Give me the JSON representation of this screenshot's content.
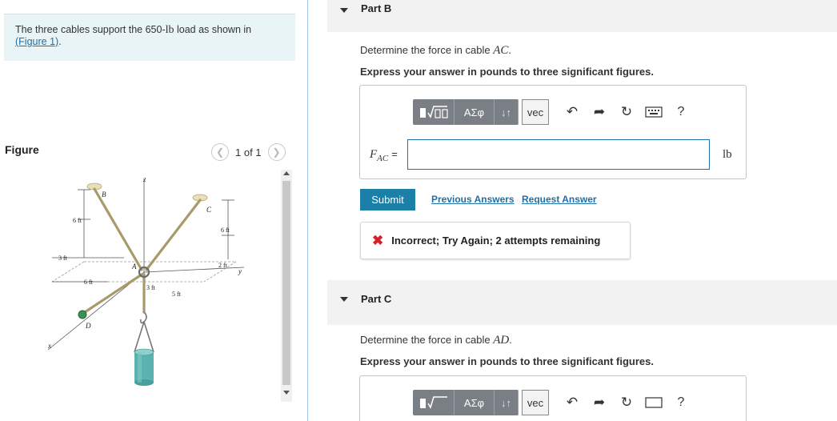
{
  "problem": {
    "text_before": "The three cables support the 650-",
    "unit": "lb",
    "text_after": " load as shown in",
    "figure_link": "(Figure 1)",
    "period": "."
  },
  "figure_panel": {
    "title": "Figure",
    "pager_text": "1 of 1",
    "prev_icon": "chevron-left-icon",
    "next_icon": "chevron-right-icon",
    "labels": {
      "B": "B",
      "C": "C",
      "A": "A",
      "D": "D",
      "z": "z",
      "y": "y",
      "x": "x",
      "dim_6ft_left": "6 ft",
      "dim_6ft_right": "6 ft",
      "dim_3ft_left": "3 ft",
      "dim_2ft": "2 ft",
      "dim_6ft_bottom": "6 ft",
      "dim_3ft_bottom": "3 ft",
      "dim_5ft": "5 ft"
    }
  },
  "part_b": {
    "title": "Part B",
    "question_prefix": "Determine the force in cable ",
    "question_var": "AC",
    "question_suffix": ".",
    "instruction": "Express your answer in pounds to three significant figures.",
    "toolbar": {
      "templates_icon": "math-templates-icon",
      "greek_label": "ΑΣφ",
      "updown_label": "↓↑",
      "vec_label": "vec",
      "undo_icon": "undo-icon",
      "redo_icon": "redo-icon",
      "reset_icon": "reset-icon",
      "keyboard_icon": "keyboard-icon",
      "help_label": "?"
    },
    "input_label_var": "F",
    "input_label_sub": "AC",
    "input_label_eq": "=",
    "input_value": "",
    "unit": "lb",
    "submit_label": "Submit",
    "previous_answers_label": "Previous Answers",
    "request_answer_label": "Request Answer",
    "feedback_message": "Incorrect; Try Again; 2 attempts remaining"
  },
  "part_c": {
    "title": "Part C",
    "question_prefix": "Determine the force in cable ",
    "question_var": "AD",
    "question_suffix": ".",
    "instruction": "Express your answer in pounds to three significant figures.",
    "toolbar": {
      "greek_label": "ΑΣφ",
      "updown_label": "↓↑",
      "vec_label": "vec",
      "help_label": "?"
    }
  },
  "colors": {
    "accent": "#1b7fa8",
    "link": "#1f6fa8",
    "error": "#d2232a",
    "problem_bg": "#e8f4f6",
    "cable": "#a89a6a",
    "weight": "#5bb3b0"
  }
}
